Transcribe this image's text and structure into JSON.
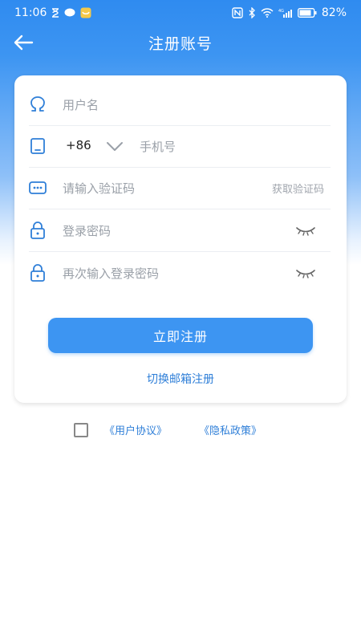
{
  "status_bar": {
    "time": "11:06",
    "battery": "82%",
    "network": "4G"
  },
  "header": {
    "title": "注册账号",
    "back_icon": "arrow-left-icon"
  },
  "form": {
    "username_placeholder": "用户名",
    "country_code": "+86",
    "phone_placeholder": "手机号",
    "code_placeholder": "请输入验证码",
    "get_code_label": "获取验证码",
    "password_placeholder": "登录密码",
    "confirm_password_placeholder": "再次输入登录密码"
  },
  "actions": {
    "submit_label": "立即注册",
    "switch_label": "切换邮箱注册"
  },
  "agreement": {
    "user_agreement": "《用户协议》",
    "privacy_policy": "《隐私政策》"
  },
  "colors": {
    "primary": "#3d95f2",
    "link": "#2f7fd8",
    "placeholder": "#9aa0a8"
  }
}
